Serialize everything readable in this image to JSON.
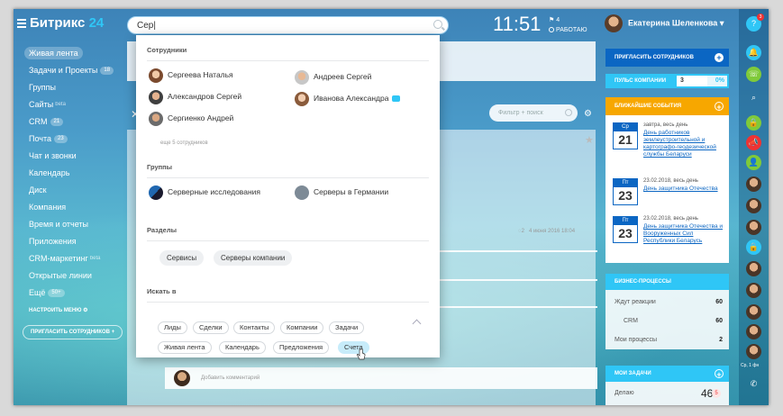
{
  "header": {
    "logo_text": "Битрикс",
    "logo_num": "24",
    "search_value": "Сер|",
    "time": "11:51",
    "notif_count": "4",
    "status": "РАБОТАЮ",
    "user_name": "Екатерина Шеленкова"
  },
  "left_menu": {
    "items": [
      {
        "label": "Живая лента",
        "badge": "",
        "sup": ""
      },
      {
        "label": "Задачи и Проекты",
        "badge": "18",
        "sup": ""
      },
      {
        "label": "Группы",
        "badge": "",
        "sup": ""
      },
      {
        "label": "Сайты",
        "badge": "",
        "sup": "beta"
      },
      {
        "label": "CRM",
        "badge": "21",
        "sup": ""
      },
      {
        "label": "Почта",
        "badge": "23",
        "sup": ""
      },
      {
        "label": "Чат и звонки",
        "badge": "",
        "sup": ""
      },
      {
        "label": "Календарь",
        "badge": "",
        "sup": ""
      },
      {
        "label": "Диск",
        "badge": "",
        "sup": ""
      },
      {
        "label": "Компания",
        "badge": "",
        "sup": ""
      },
      {
        "label": "Время и отчеты",
        "badge": "",
        "sup": ""
      },
      {
        "label": "Приложения",
        "badge": "",
        "sup": ""
      },
      {
        "label": "CRM-маркетинг",
        "badge": "",
        "sup": "beta"
      },
      {
        "label": "Открытые линии",
        "badge": "",
        "sup": ""
      },
      {
        "label": "Ещё",
        "badge": "50+",
        "sup": ""
      }
    ],
    "configure_menu": "НАСТРОИТЬ МЕНЮ",
    "invite": "ПРИГЛАСИТЬ СОТРУДНИКОВ"
  },
  "feed": {
    "filter_placeholder": "Фильтр + поиск",
    "meta_comments": "2",
    "meta_date": "4 июня 2016 18:04",
    "add_comment": "Добавить комментарий"
  },
  "dropdown": {
    "employees_title": "Сотрудники",
    "employees": [
      "Сергеева Наталья",
      "Андреев Сергей",
      "Александров Сергей",
      "Иванова Александра",
      "Сергиенко Андрей"
    ],
    "more_employees": "еще 5 сотрудников",
    "groups_title": "Группы",
    "groups": [
      "Серверные исследования",
      "Серверы в Германии"
    ],
    "sections_title": "Разделы",
    "sections": [
      "Сервисы",
      "Серверы компании"
    ],
    "search_in_title": "Искать в",
    "search_in": [
      "Лиды",
      "Сделки",
      "Контакты",
      "Компании",
      "Задачи",
      "Живая лента",
      "Календарь",
      "Предложения",
      "Счета"
    ]
  },
  "right_panel": {
    "invite_button": "ПРИГЛАСИТЬ СОТРУДНИКОВ",
    "pulse_label": "ПУЛЬС КОМПАНИИ",
    "pulse_value": "3",
    "pulse_percent": "0%",
    "events_title": "БЛИЖАЙШИЕ СОБЫТИЯ",
    "events": [
      {
        "dow": "Ср",
        "day": "21",
        "when": "завтра, весь день",
        "title": "День работников землеустроительной и картографо-геодезической службы Беларуси"
      },
      {
        "dow": "Пт",
        "day": "23",
        "when": "23.02.2018, весь день",
        "title": "День защитника Отечества"
      },
      {
        "dow": "Пт",
        "day": "23",
        "when": "23.02.2018, весь день",
        "title": "День защитника Отечества и Вооруженных Сил Республики Беларусь"
      }
    ],
    "bp_title": "БИЗНЕС-ПРОЦЕССЫ",
    "bp_rows": [
      {
        "label": "Ждут реакции",
        "value": "60"
      },
      {
        "label": "CRM",
        "value": "60"
      },
      {
        "label": "Мои процессы",
        "value": "2"
      }
    ],
    "tasks_title": "МОИ ЗАДАЧИ",
    "tasks_label": "Делаю",
    "tasks_count": "46",
    "tasks_badge": "5"
  },
  "right_bar": {
    "help_badge": "3",
    "bottom_label": "Ср, 1 фн"
  },
  "colors": {
    "accent": "#2fc6f6",
    "brand_blue": "#0b66c3",
    "events_orange": "#f7a700"
  }
}
